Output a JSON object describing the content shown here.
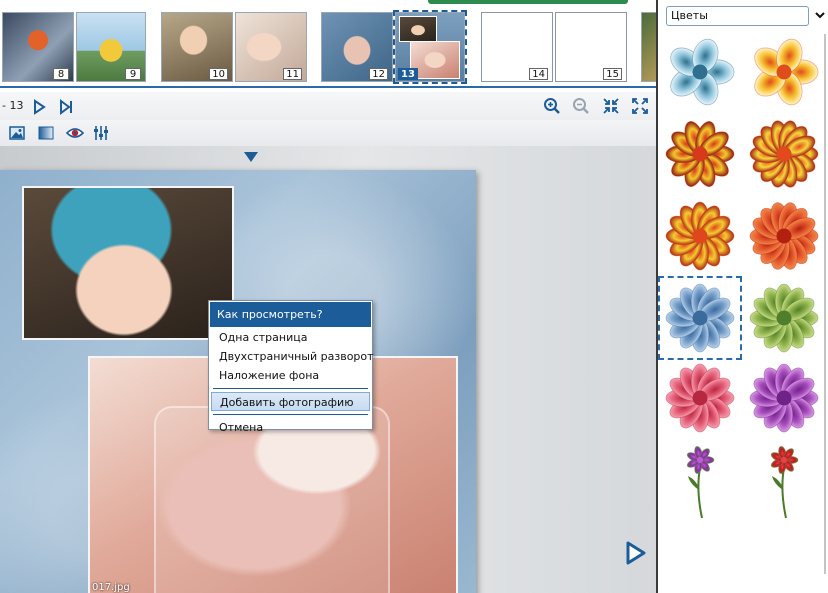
{
  "thumbnails": [
    {
      "num": "8",
      "kind": "photo",
      "style": "p-giraffe",
      "selected": false
    },
    {
      "num": "9",
      "kind": "photo",
      "style": "p-house",
      "selected": false
    },
    {
      "num": "10",
      "kind": "photo",
      "style": "p-baby1",
      "selected": false
    },
    {
      "num": "11",
      "kind": "photo",
      "style": "p-hands",
      "selected": false
    },
    {
      "num": "12",
      "kind": "photo",
      "style": "p-hands2",
      "selected": false
    },
    {
      "num": "13",
      "kind": "photo",
      "style": "p-spread13",
      "selected": true
    },
    {
      "num": "14",
      "kind": "blank",
      "style": "",
      "selected": false
    },
    {
      "num": "15",
      "kind": "blank",
      "style": "",
      "selected": false
    }
  ],
  "navigation": {
    "page_range_text": "- 13",
    "prev_icon": "play-right-icon",
    "last_icon": "skip-to-end-icon"
  },
  "view_tools": {
    "zoom_in_icon": "zoom-in-icon",
    "zoom_out_icon": "zoom-out-icon",
    "fit_icon": "fit-to-window-icon",
    "fullscreen_icon": "fullscreen-icon"
  },
  "edit_tools": {
    "image_icon": "image-icon",
    "gradient_icon": "gradient-icon",
    "preview_icon": "eye-icon",
    "adjust_icon": "sliders-icon"
  },
  "canvas": {
    "photo_caption": "017.jpg"
  },
  "context_menu": {
    "title": "Как просмотреть?",
    "items": [
      {
        "label": "Одна страница",
        "highlighted": false
      },
      {
        "label": "Двухстраничный разворот",
        "highlighted": false
      },
      {
        "label": "Наложение фона",
        "highlighted": false
      },
      {
        "label": "Добавить фотографию",
        "highlighted": true
      },
      {
        "label": "Отмена",
        "highlighted": false
      }
    ]
  },
  "right_panel": {
    "category": "Цветы",
    "flowers": [
      {
        "name": "blue-flower",
        "colors": [
          "#8fc6dc",
          "#2f6f8f",
          "#e8f4fa"
        ],
        "petals": 5,
        "selected": false
      },
      {
        "name": "orange-flower",
        "colors": [
          "#f6c02e",
          "#e04d1c",
          "#fff6c8"
        ],
        "petals": 5,
        "selected": false
      },
      {
        "name": "red-yellow-flower-1",
        "colors": [
          "#f3c62c",
          "#d63a1a",
          "#8a1a10"
        ],
        "petals": 10,
        "selected": false
      },
      {
        "name": "red-yellow-flower-2",
        "colors": [
          "#f7d53a",
          "#e24a1e",
          "#a02412"
        ],
        "petals": 14,
        "selected": false
      },
      {
        "name": "yellow-red-flower",
        "colors": [
          "#f4cc30",
          "#e0461c",
          "#b02a14"
        ],
        "petals": 12,
        "selected": false
      },
      {
        "name": "red-flower",
        "colors": [
          "#e4572c",
          "#b3200f",
          "#f08a4a"
        ],
        "petals": 14,
        "selected": false
      },
      {
        "name": "blue-pastel-flower",
        "colors": [
          "#6f98c4",
          "#3b6a9c",
          "#b8d2ea"
        ],
        "petals": 12,
        "selected": true
      },
      {
        "name": "green-flower",
        "colors": [
          "#8db04a",
          "#4f7f2a",
          "#c8dc8a"
        ],
        "petals": 12,
        "selected": false
      },
      {
        "name": "pink-flower",
        "colors": [
          "#e35a74",
          "#b5283f",
          "#f4a0b0"
        ],
        "petals": 12,
        "selected": false
      },
      {
        "name": "purple-flower",
        "colors": [
          "#a44ab8",
          "#6f2288",
          "#d898e4"
        ],
        "petals": 12,
        "selected": false
      },
      {
        "name": "purple-stem-flower",
        "colors": [
          "#8a2fa8",
          "#c05ad6",
          "#4a7a2a"
        ],
        "petals": 7,
        "selected": false
      },
      {
        "name": "red-stem-flower",
        "colors": [
          "#c8161e",
          "#e84048",
          "#4a7a2a"
        ],
        "petals": 7,
        "selected": false
      }
    ]
  },
  "colors": {
    "accent": "#1b5c99",
    "menu_highlight": "#c6dcf2"
  }
}
